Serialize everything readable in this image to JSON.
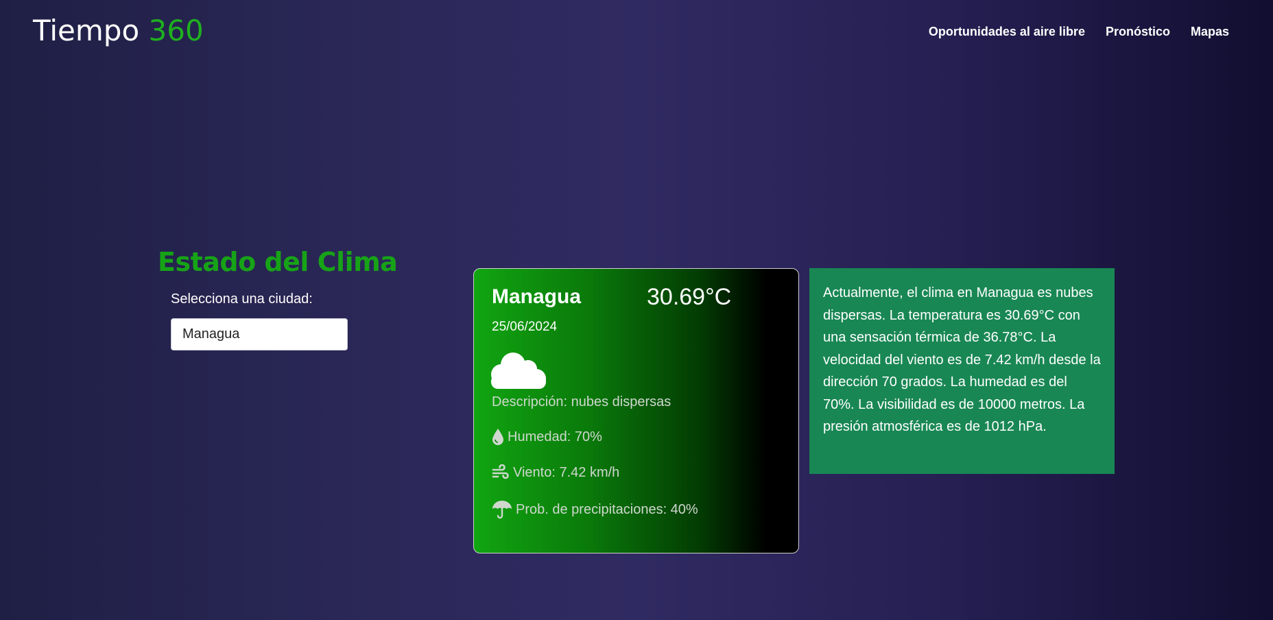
{
  "header": {
    "logo_main": "Tiempo",
    "logo_accent": "360",
    "nav": [
      "Oportunidades al aire libre",
      "Pronóstico",
      "Mapas"
    ]
  },
  "selector": {
    "title": "Estado del Clima",
    "label": "Selecciona una ciudad:",
    "value": "Managua"
  },
  "card": {
    "city": "Managua",
    "temperature": "30.69°C",
    "date": "25/06/2024",
    "icon": "cloud-icon",
    "description": "Descripción: nubes dispersas",
    "humidity": "Humedad: 70%",
    "wind": "Viento: 7.42 km/h",
    "precipitation": "Prob. de precipitaciones: 40%"
  },
  "summary": {
    "text": "Actualmente, el clima en Managua es nubes dispersas. La temperatura es 30.69°C con una sensación térmica de 36.78°C. La velocidad del viento es de 7.42 km/h desde la dirección 70 grados. La humedad es del 70%. La visibilidad es de 10000 metros. La presión atmosférica es de 1012 hPa."
  },
  "colors": {
    "accent_green": "#1eb11e",
    "summary_bg": "#198754",
    "card_gradient_start": "#11a511",
    "card_gradient_end": "#000000"
  }
}
